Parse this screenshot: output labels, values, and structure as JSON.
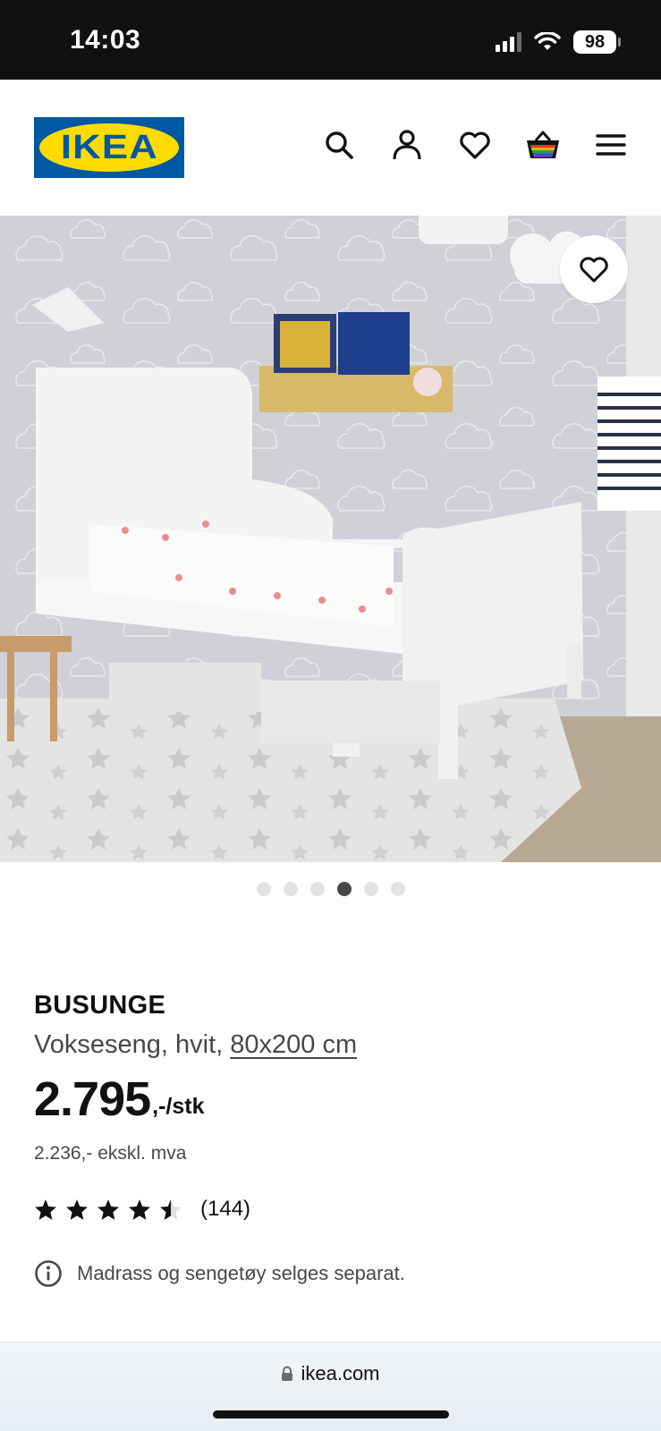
{
  "status_bar": {
    "time": "14:03",
    "battery": "98",
    "icons": [
      "cellular-signal-icon",
      "wifi-icon",
      "battery-icon"
    ]
  },
  "header": {
    "logo_text": "IKEA",
    "icons": [
      "search-icon",
      "account-icon",
      "heart-icon",
      "basket-icon",
      "menu-icon"
    ]
  },
  "hero": {
    "image_icons": [
      "heart-icon"
    ],
    "dots_count": 6,
    "active_dot": 4
  },
  "product": {
    "name": "BUSUNGE",
    "desc_prefix": "Vokseseng, hvit, ",
    "desc_size": "80x200 cm",
    "price_main": "2.795",
    "price_unit": ",-/stk",
    "price_ex_vat": "2.236,- ekskl. mva",
    "rating": 4.5,
    "rating_count": "(144)",
    "notice": "Madrass og sengetøy selges separat."
  },
  "browser": {
    "url": "ikea.com"
  },
  "colors": {
    "ikea_blue": "#0058a3",
    "ikea_yellow": "#ffdb00",
    "text": "#111111",
    "muted_text": "#484848"
  }
}
